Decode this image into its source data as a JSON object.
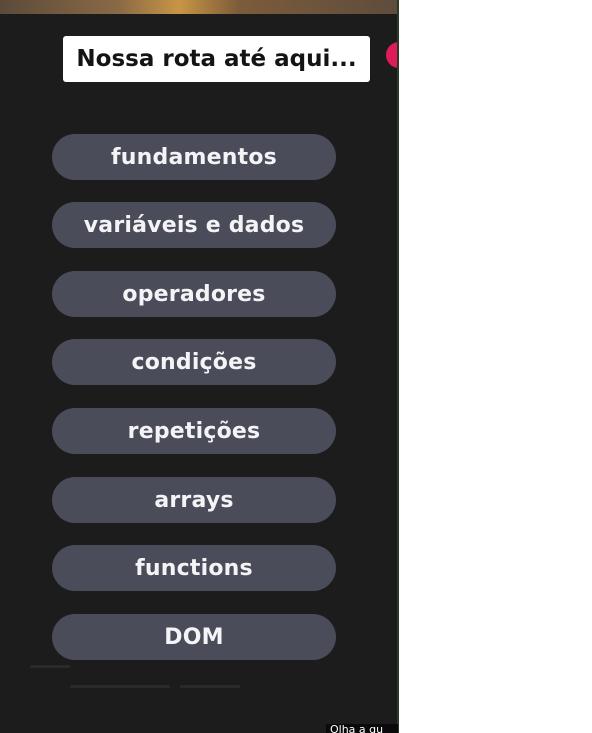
{
  "header": {
    "title": "Nossa rota até aqui..."
  },
  "route": {
    "items": [
      {
        "label": "fundamentos"
      },
      {
        "label": "variáveis e dados"
      },
      {
        "label": "operadores"
      },
      {
        "label": "condições"
      },
      {
        "label": "repetições"
      },
      {
        "label": "arrays"
      },
      {
        "label": "functions"
      },
      {
        "label": "DOM"
      }
    ]
  },
  "caption": {
    "text": "Olha a gu"
  },
  "colors": {
    "background": "#1c1c1d",
    "pill": "#4a4c5a",
    "accent_dot": "#e01b5a",
    "title_card": "#ffffff"
  }
}
